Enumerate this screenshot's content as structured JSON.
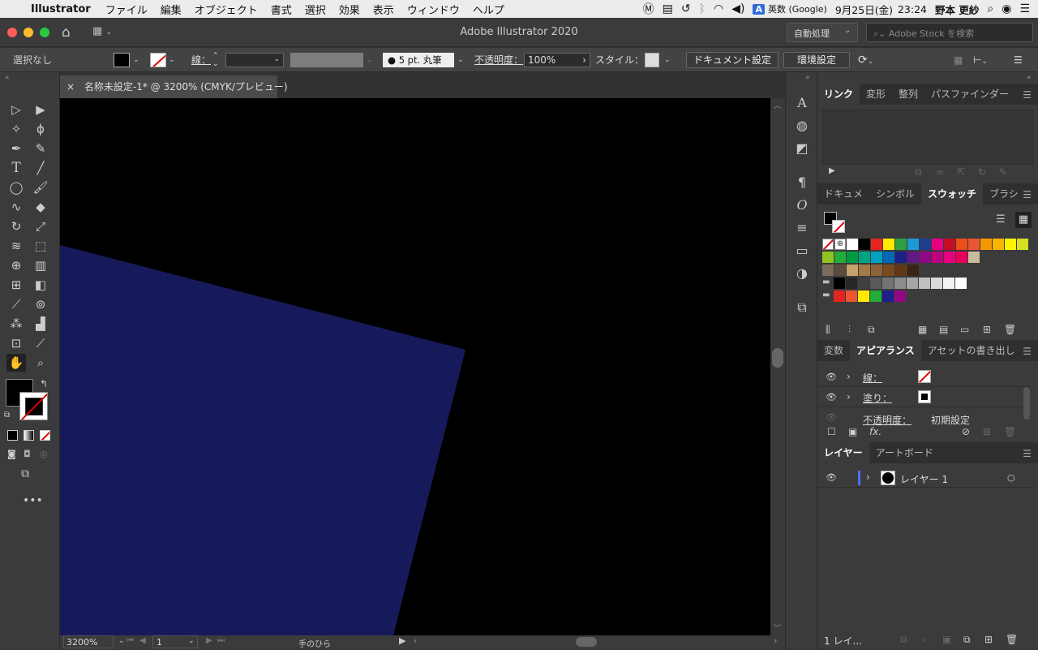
{
  "menubar": {
    "app": "Illustrator",
    "items": [
      "ファイル",
      "編集",
      "オブジェクト",
      "書式",
      "選択",
      "効果",
      "表示",
      "ウィンドウ",
      "ヘルプ"
    ],
    "ime": "A",
    "ime_label": "英数 (Google)",
    "date": "9月25日(金)",
    "time": "23:24",
    "user": "野本 更紗"
  },
  "titlebar": {
    "title": "Adobe Illustrator 2020",
    "workspace": "自動処理",
    "search_placeholder": "Adobe Stock を検索"
  },
  "control": {
    "selection": "選択なし",
    "stroke_label": "線：",
    "brush": "5 pt. 丸筆",
    "opacity_label": "不透明度：",
    "opacity": "100%",
    "style_label": "スタイル：",
    "doc_setup": "ドキュメント設定",
    "prefs": "環境設定"
  },
  "doc": {
    "tab": "名称未設定-1* @ 3200% (CMYK/プレビュー)",
    "close": "×"
  },
  "status": {
    "zoom": "3200%",
    "page": "1",
    "tool": "手のひら"
  },
  "canvas": {
    "shape_color": "#171a5a",
    "bg": "#000000"
  },
  "panels": {
    "top_tabs": [
      "リンク",
      "変形",
      "整列",
      "パスファインダー"
    ],
    "mid_tabs": [
      "ドキュメ",
      "シンボル",
      "スウォッチ",
      "ブラシ"
    ],
    "app_tabs": [
      "変数",
      "アピアランス",
      "アセットの書き出し"
    ],
    "appearance": {
      "stroke": "線：",
      "fill": "塗り：",
      "opacity": "不透明度：",
      "opacity_val": "初期設定",
      "fx": "fx."
    },
    "layer_tabs": [
      "レイヤー",
      "アートボード"
    ],
    "layer_name": "レイヤー 1",
    "layer_count": "1 レイ..."
  },
  "swatches": {
    "row1": [
      "#ffffff",
      "#000000",
      "#e52420",
      "#ffea00",
      "#2ea043",
      "#1d9ad6",
      "#1d3f8f",
      "#e4007f",
      "#c30d23",
      "#e94e1b",
      "#ea5532",
      "#f39800",
      "#f8b500",
      "#fff100",
      "#d7df23"
    ],
    "row2": [
      "#8fc31f",
      "#22ac38",
      "#009944",
      "#00a381",
      "#00a0c1",
      "#0068b7",
      "#1d2088",
      "#601986",
      "#920783",
      "#be0081",
      "#e4007f",
      "#e5005a",
      "#c9bc9c"
    ],
    "row3": [
      "#7d6b5d",
      "#5e4a3d",
      "#c7a26b",
      "#a47a44",
      "#8c6239",
      "#7a4a1d",
      "#603813",
      "#3c2415"
    ],
    "row4": [
      "#000000",
      "#262626",
      "#404040",
      "#595959",
      "#737373",
      "#8c8c8c",
      "#a6a6a6",
      "#bfbfbf",
      "#d9d9d9",
      "#f2f2f2",
      "#ffffff"
    ],
    "row5": [
      "#e52420",
      "#ea5532",
      "#ffea00",
      "#22ac38",
      "#1d2088",
      "#920783"
    ]
  }
}
